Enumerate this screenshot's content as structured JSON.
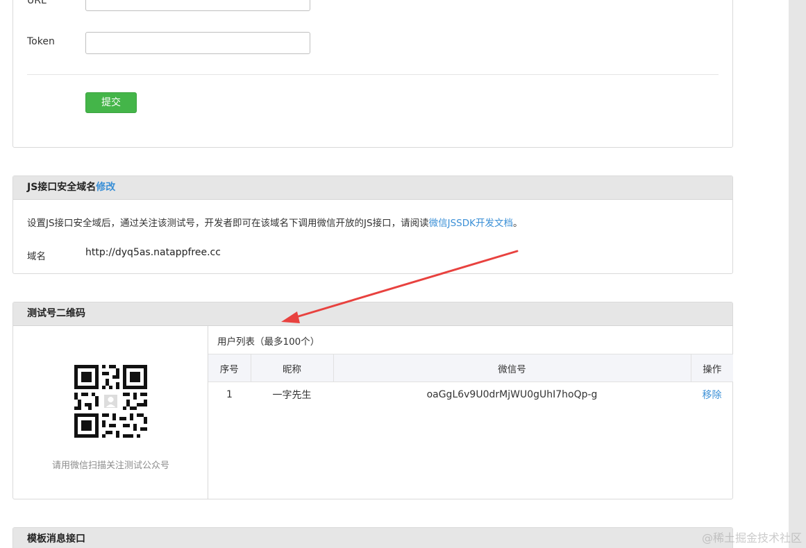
{
  "config_form": {
    "url_label": "URL",
    "token_label": "Token",
    "url_value": "",
    "token_value": "",
    "submit_label": "提交"
  },
  "js_domain": {
    "title": "JS接口安全域名",
    "edit_link": "修改",
    "description_prefix": "设置JS接口安全域后，通过关注该测试号，开发者即可在该域名下调用微信开放的JS接口，请阅读",
    "doc_link": "微信JSSDK开发文档",
    "description_suffix": "。",
    "domain_label": "域名",
    "domain_value": "http://dyq5as.natappfree.cc"
  },
  "qr_section": {
    "title": "测试号二维码",
    "qr_hint": "请用微信扫描关注测试公众号",
    "user_list_title": "用户列表（最多100个）",
    "columns": [
      "序号",
      "昵称",
      "微信号",
      "操作"
    ],
    "rows": [
      {
        "index": "1",
        "nickname": "一字先生",
        "wechat_id": "oaGgL6v9U0drMjWU0gUhI7hoQp-g",
        "action": "移除"
      }
    ]
  },
  "template_section": {
    "title": "模板消息接口"
  },
  "watermark": "@稀土掘金技术社区",
  "colors": {
    "accent": "#3a8fd6",
    "submit": "#44b549",
    "arrow": "#e8423f"
  }
}
